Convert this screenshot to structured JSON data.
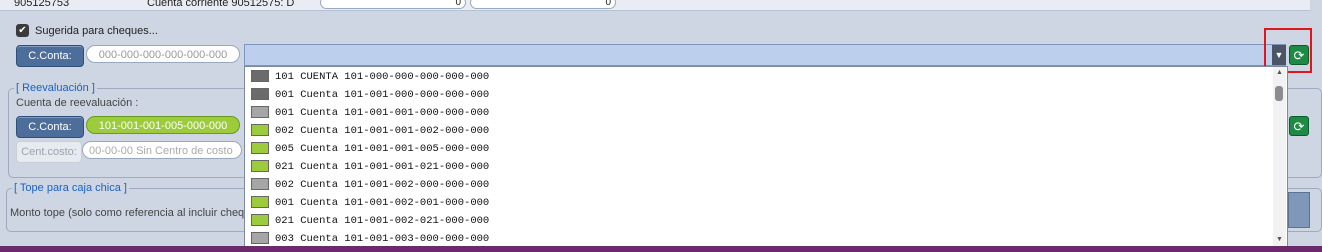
{
  "top_row": {
    "account": "905125753",
    "account_name": "Cuenta corriente 90512575: D",
    "value1": "0",
    "value2": "0"
  },
  "checkbox": {
    "label": "Sugerida para cheques...",
    "checked": true
  },
  "cconta1": {
    "button": "C.Conta:",
    "placeholder": "000-000-000-000-000-000"
  },
  "reevaluacion": {
    "legend": "[ Reevaluación ]",
    "label": "Cuenta de reevaluación :",
    "button": "C.Conta:",
    "value": "101-001-001-005-000-000",
    "cent_label": "Cent.costo:",
    "cent_value": "00-00-00 Sin Centro de costo"
  },
  "tope": {
    "legend": "[ Tope para caja chica ]",
    "label": "Monto tope (solo como referencia al incluir cheq"
  },
  "dropdown": {
    "items": [
      {
        "text": "101 CUENTA 101-000-000-000-000-000",
        "color": "#6b6b6b"
      },
      {
        "text": "001 Cuenta 101-001-000-000-000-000",
        "color": "#6b6b6b"
      },
      {
        "text": "001 Cuenta 101-001-001-000-000-000",
        "color": "#a6a6a6"
      },
      {
        "text": "002 Cuenta 101-001-001-002-000-000",
        "color": "#9ccc3c"
      },
      {
        "text": "005 Cuenta 101-001-001-005-000-000",
        "color": "#9ccc3c"
      },
      {
        "text": "021 Cuenta 101-001-001-021-000-000",
        "color": "#9ccc3c"
      },
      {
        "text": "002 Cuenta 101-001-002-000-000-000",
        "color": "#a6a6a6"
      },
      {
        "text": "001 Cuenta 101-001-002-001-000-000",
        "color": "#9ccc3c"
      },
      {
        "text": "021 Cuenta 101-001-002-021-000-000",
        "color": "#9ccc3c"
      },
      {
        "text": "003 Cuenta 101-001-003-000-000-000",
        "color": "#a6a6a6"
      }
    ]
  },
  "icons": {
    "check": "check-icon",
    "arrow": "chevron-down-icon",
    "refresh": "refresh-icon"
  }
}
